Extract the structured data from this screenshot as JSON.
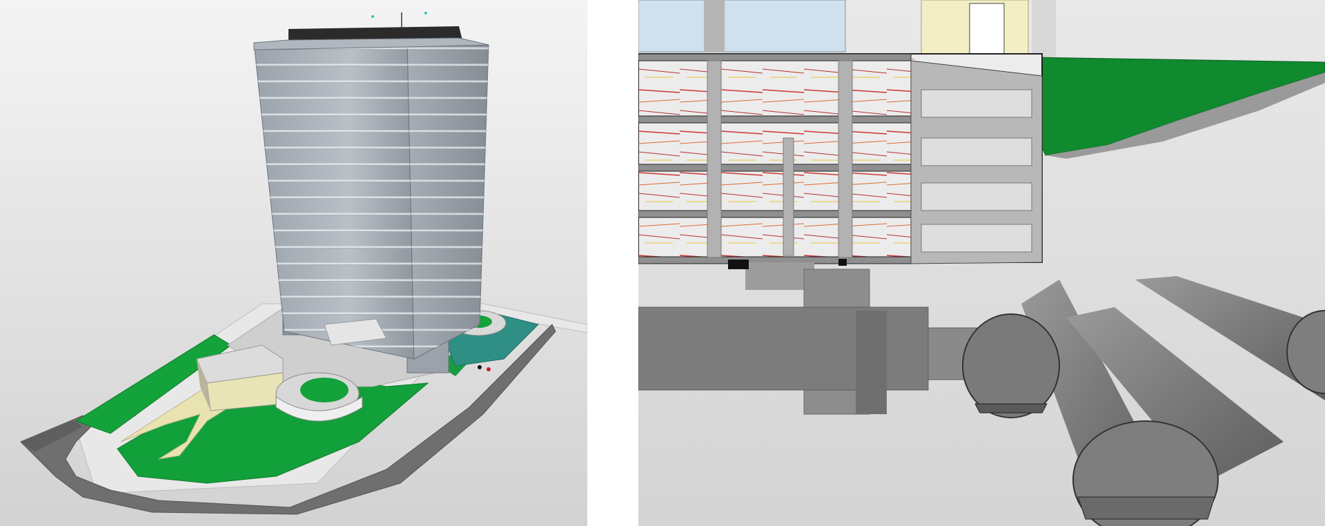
{
  "panels": [
    {
      "id": "exterior-view",
      "description_key": "building-exterior-3d"
    },
    {
      "id": "section-view",
      "description_key": "basement-section-tunnels"
    }
  ],
  "colors": {
    "background_gray": "#dcdcdc",
    "facade_gray": "#a9b0b8",
    "lawn_green": "#13a03a",
    "road_gray": "#6d6d6d",
    "roof_black": "#2b2b2b",
    "pale_yellow": "#e9e6b8",
    "pipe_red": "#cc1f1f",
    "tunnel_gray": "#8a8a8a"
  }
}
